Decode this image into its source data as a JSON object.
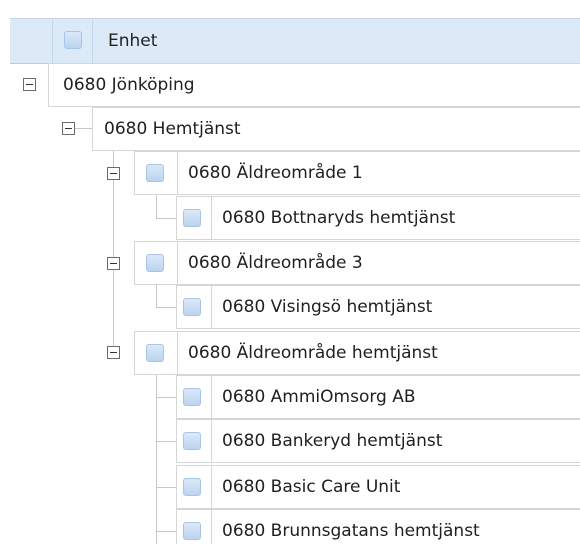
{
  "header": {
    "column_label": "Enhet"
  },
  "rows": [
    {
      "label": "0680 Jönköping"
    },
    {
      "label": "0680 Hemtjänst"
    },
    {
      "label": "0680 Äldreområde 1"
    },
    {
      "label": "0680 Bottnaryds hemtjänst"
    },
    {
      "label": "0680 Äldreområde 3"
    },
    {
      "label": "0680 Visingsö hemtjänst"
    },
    {
      "label": "0680 Äldreområde hemtjänst"
    },
    {
      "label": "0680 AmmiOmsorg AB"
    },
    {
      "label": "0680 Bankeryd hemtjänst"
    },
    {
      "label": "0680 Basic Care Unit"
    },
    {
      "label": "0680 Brunnsgatans hemtjänst"
    }
  ],
  "colors": {
    "header_bg": "#dce9f7",
    "checkbox_fill": "#c9dcf2",
    "row_border": "#d5d5d5",
    "tree_line": "#c8c8c8"
  }
}
